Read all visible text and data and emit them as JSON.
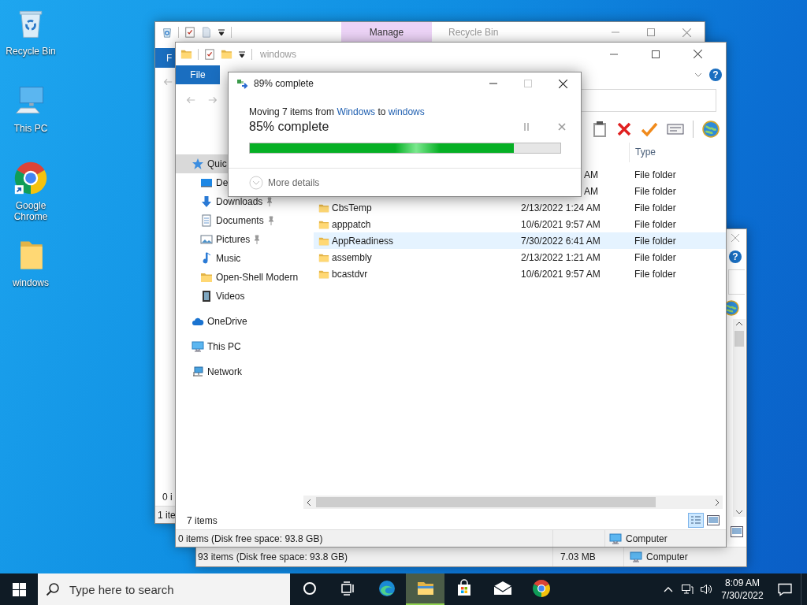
{
  "desktop_icons": [
    {
      "label": "Recycle Bin",
      "kind": "recycle-bin"
    },
    {
      "label": "This PC",
      "kind": "pc"
    },
    {
      "label": "Google Chrome",
      "kind": "chrome"
    },
    {
      "label": "windows",
      "kind": "folder"
    }
  ],
  "recycle_bin_window": {
    "context_tab": "Manage",
    "title": "Recycle Bin",
    "file_tab": "F",
    "pane_status": "0 i",
    "status_bar": "1 ite"
  },
  "back_window": {
    "help": "?",
    "status_bar": {
      "items": "93 items (Disk free space: 93.8 GB)",
      "size": "7.03 MB",
      "location": "Computer"
    }
  },
  "explorer": {
    "title": "windows",
    "file_tab": "File",
    "help": "?",
    "columns": [
      "Type"
    ],
    "sidebar": [
      {
        "label": "Quic",
        "kind": "quick-access",
        "selected": true,
        "children": [
          {
            "label": "De",
            "kind": "desktop",
            "selected": false,
            "pinned": false
          },
          {
            "label": "Downloads",
            "kind": "downloads",
            "selected": false,
            "pinned": true
          },
          {
            "label": "Documents",
            "kind": "documents",
            "selected": false,
            "pinned": true
          },
          {
            "label": "Pictures",
            "kind": "pictures",
            "selected": false,
            "pinned": true
          },
          {
            "label": "Music",
            "kind": "music",
            "selected": false,
            "pinned": false
          },
          {
            "label": "Open-Shell Modern",
            "kind": "folder",
            "selected": false,
            "pinned": false
          },
          {
            "label": "Videos",
            "kind": "videos",
            "selected": false,
            "pinned": false
          }
        ]
      },
      {
        "label": "OneDrive",
        "kind": "onedrive",
        "selected": false
      },
      {
        "label": "This PC",
        "kind": "pc",
        "selected": false
      },
      {
        "label": "Network",
        "kind": "network",
        "selected": false
      }
    ],
    "rows": [
      {
        "date": "AM",
        "type": "File folder",
        "selected": false
      },
      {
        "date": "AM",
        "type": "File folder",
        "selected": false
      },
      {
        "name": "CbsTemp",
        "date": "2/13/2022 1:24 AM",
        "type": "File folder",
        "selected": false
      },
      {
        "name": "apppatch",
        "date": "10/6/2021 9:57 AM",
        "type": "File folder",
        "selected": false
      },
      {
        "name": "AppReadiness",
        "date": "7/30/2022 6:41 AM",
        "type": "File folder",
        "selected": true
      },
      {
        "name": "assembly",
        "date": "2/13/2022 1:21 AM",
        "type": "File folder",
        "selected": false
      },
      {
        "name": "bcastdvr",
        "date": "10/6/2021 9:57 AM",
        "type": "File folder",
        "selected": false
      }
    ],
    "item_count": "7 items",
    "views": [
      {
        "kind": "details",
        "selected": true
      },
      {
        "kind": "large-icons",
        "selected": false
      }
    ],
    "status_bar": {
      "items": "0 items (Disk free space: 93.8 GB)",
      "location": "Computer"
    }
  },
  "dialog": {
    "title": "89% complete",
    "message": [
      {
        "kind": "text",
        "text": "Moving 7 items from"
      },
      {
        "kind": "link",
        "text": "Windows"
      },
      {
        "kind": "text",
        "text": "to"
      },
      {
        "kind": "link",
        "text": "windows"
      }
    ],
    "progress": "85% complete",
    "level": 0.85,
    "details": "More details"
  },
  "taskbar": {
    "search_placeholder": "Type here to search",
    "apps": [
      {
        "kind": "edge",
        "selected": false
      },
      {
        "kind": "explorer",
        "selected": true
      },
      {
        "kind": "store",
        "selected": false
      },
      {
        "kind": "mail",
        "selected": false
      },
      {
        "kind": "chrome",
        "selected": false
      }
    ],
    "time": "8:09 AM",
    "date": "7/30/2022"
  }
}
